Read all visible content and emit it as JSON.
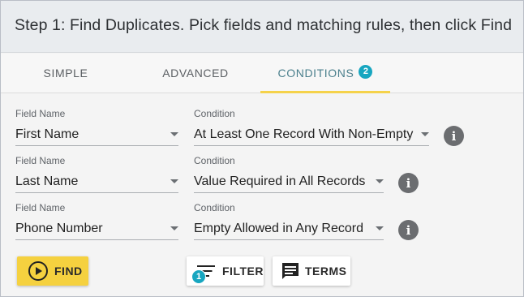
{
  "header": {
    "title": "Step 1: Find Duplicates. Pick fields and matching rules, then click Find"
  },
  "tabs": [
    {
      "label": "SIMPLE"
    },
    {
      "label": "ADVANCED"
    },
    {
      "label": "CONDITIONS",
      "badge": "2",
      "active": true
    }
  ],
  "rows": [
    {
      "field_label": "Field Name",
      "field_value": "First Name",
      "condition_label": "Condition",
      "condition_value": "At Least One Record With Non-Empty"
    },
    {
      "field_label": "Field Name",
      "field_value": "Last Name",
      "condition_label": "Condition",
      "condition_value": "Value Required in All Records"
    },
    {
      "field_label": "Field Name",
      "field_value": "Phone Number",
      "condition_label": "Condition",
      "condition_value": "Empty Allowed in Any Record"
    }
  ],
  "buttons": {
    "find": "FIND",
    "filter": "FILTER",
    "filter_badge": "1",
    "terms": "TERMS"
  },
  "icons": {
    "info": "info-icon",
    "play": "play-circle-icon",
    "filter": "filter-lines-icon",
    "terms": "comment-text-icon"
  },
  "colors": {
    "accent_yellow": "#f5d13f",
    "badge_teal": "#17a6c0",
    "active_tab_text": "#4a7f8c"
  }
}
